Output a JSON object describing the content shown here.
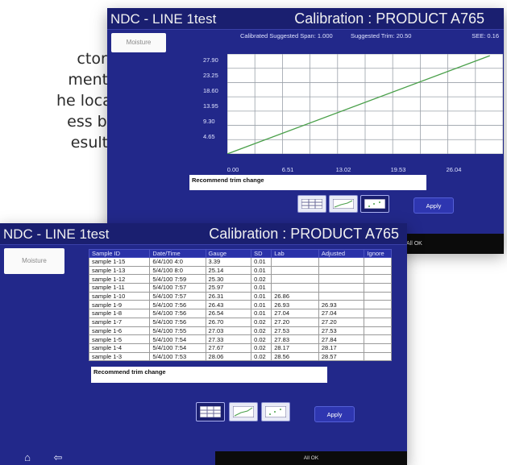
{
  "background_text": [
    "ctory",
    "ments",
    "he local",
    "ess by",
    "esults"
  ],
  "back_screen": {
    "title_left": "NDC - LINE 1test",
    "title_right": "Calibration : PRODUCT A765",
    "tab_label": "Moisture",
    "summary": {
      "span": "Calibrated Suggested Span: 1.000",
      "trim": "Suggested Trim: 20.50",
      "see": "SEE: 0.16"
    },
    "chart_data": {
      "type": "line",
      "y_ticks": [
        "27.90",
        "23.25",
        "18.60",
        "13.95",
        "9.30",
        "4.65"
      ],
      "x_ticks": [
        "0.00",
        "6.51",
        "13.02",
        "19.53",
        "26.04"
      ],
      "series": [
        {
          "color": "#4aa04a",
          "points": [
            [
              0.0,
              0.0
            ],
            [
              31.0,
              32.0
            ]
          ]
        }
      ],
      "xlim": [
        0,
        32.55
      ],
      "ylim": [
        0,
        32.55
      ],
      "grid": true
    },
    "message": "Recommend trim change",
    "apply_label": "Apply"
  },
  "front_screen": {
    "title_left": "NDC - LINE 1test",
    "title_right": "Calibration : PRODUCT A765",
    "tab_label": "Moisture",
    "table": {
      "columns": [
        "Sample ID",
        "Date/Time",
        "Gauge",
        "SD",
        "Lab",
        "Adjusted",
        "Ignore"
      ],
      "rows": [
        [
          "sample 1-15",
          "6/4/100 4:0",
          "3.39",
          "0.01",
          "",
          "",
          ""
        ],
        [
          "sample 1-13",
          "5/4/100 8:0",
          "25.14",
          "0.01",
          "",
          "",
          ""
        ],
        [
          "sample 1-12",
          "5/4/100 7:59",
          "25.30",
          "0.02",
          "",
          "",
          ""
        ],
        [
          "sample 1-11",
          "5/4/100 7:57",
          "25.97",
          "0.01",
          "",
          "",
          ""
        ],
        [
          "sample 1-10",
          "5/4/100 7:57",
          "26.31",
          "0.01",
          "26.86",
          "",
          ""
        ],
        [
          "sample 1-9",
          "5/4/100 7:56",
          "26.43",
          "0.01",
          "26.93",
          "26.93",
          ""
        ],
        [
          "sample 1-8",
          "5/4/100 7:56",
          "26.54",
          "0.01",
          "27.04",
          "27.04",
          ""
        ],
        [
          "sample 1-7",
          "5/4/100 7:56",
          "26.70",
          "0.02",
          "27.20",
          "27.20",
          ""
        ],
        [
          "sample 1-6",
          "5/4/100 7:55",
          "27.03",
          "0.02",
          "27.53",
          "27.53",
          ""
        ],
        [
          "sample 1-5",
          "5/4/100 7:54",
          "27.33",
          "0.02",
          "27.83",
          "27.84",
          ""
        ],
        [
          "sample 1-4",
          "5/4/100 7:54",
          "27.67",
          "0.02",
          "28.17",
          "28.17",
          ""
        ],
        [
          "sample 1-3",
          "5/4/100 7:53",
          "28.06",
          "0.02",
          "28.56",
          "28.57",
          ""
        ]
      ]
    },
    "message": "Recommend trim change",
    "apply_label": "Apply",
    "status": "All OK",
    "nav": {
      "home_glyph": "⌂",
      "back_glyph": "⇦"
    }
  },
  "right_status": "All OK",
  "colors": {
    "screen_bg": "#22288a",
    "plot_line": "#4aa04a"
  }
}
